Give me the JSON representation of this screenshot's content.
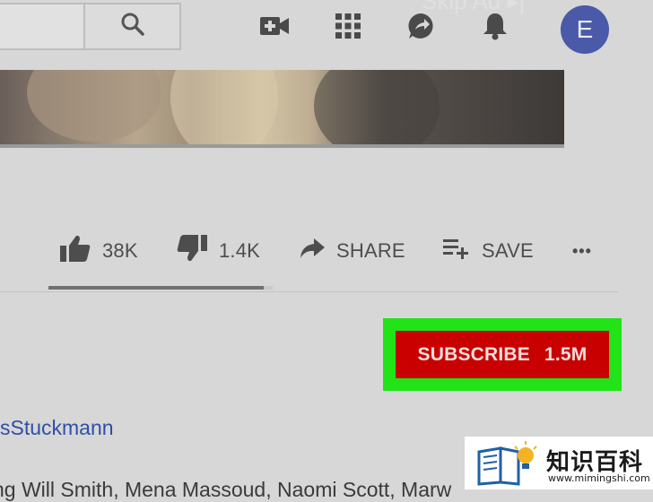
{
  "header": {
    "search": {
      "value": "",
      "placeholder": ""
    },
    "skip_ad_text": "Skip Ad ▸|",
    "avatar_letter": "E"
  },
  "video": {
    "progress": 1.0
  },
  "actions": {
    "likes": "38K",
    "dislikes": "1.4K",
    "share_label": "SHARE",
    "save_label": "SAVE",
    "more_label": "•••",
    "like_ratio": 0.96
  },
  "subscribe": {
    "label": "SUBSCRIBE",
    "count": "1.5M",
    "highlight_color": "#22e317",
    "button_color": "#c90000"
  },
  "channel": {
    "name": "sStuckmann"
  },
  "description": {
    "text": "ng Will Smith, Mena Massoud, Naomi Scott, Marw"
  },
  "watermark": {
    "text": "知识百科",
    "url": "www.mimingshi.com"
  }
}
